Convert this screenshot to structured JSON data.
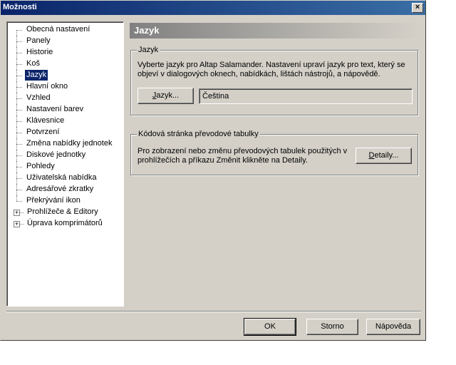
{
  "window": {
    "title": "Možnosti",
    "close_glyph": "×"
  },
  "tree": {
    "items": [
      {
        "label": "Obecná nastavení"
      },
      {
        "label": "Panely"
      },
      {
        "label": "Historie"
      },
      {
        "label": "Koš"
      },
      {
        "label": "Jazyk",
        "selected": true
      },
      {
        "label": "Hlavní okno"
      },
      {
        "label": "Vzhled"
      },
      {
        "label": "Nastavení barev"
      },
      {
        "label": "Klávesnice"
      },
      {
        "label": "Potvrzení"
      },
      {
        "label": "Změna nabídky jednotek"
      },
      {
        "label": "Diskové jednotky"
      },
      {
        "label": "Pohledy"
      },
      {
        "label": "Uživatelská nabídka"
      },
      {
        "label": "Adresářové zkratky"
      },
      {
        "label": "Překrývání ikon"
      },
      {
        "label": "Prohlížeče & Editory",
        "expandable": true
      },
      {
        "label": "Úprava komprimátorů",
        "expandable": true
      }
    ],
    "expander_glyph": "+"
  },
  "page": {
    "title": "Jazyk",
    "language_group": {
      "title": "Jazyk",
      "description_line1": "Vyberte jazyk pro Altap Salamander. Nastavení upraví jazyk pro text, který se",
      "description_line2": "objeví v dialogových oknech, nabídkách, lištách nástrojů, a nápovědě.",
      "button_mnemonic": "J",
      "button_rest": "azyk...",
      "current_language": "Čeština"
    },
    "codepage_group": {
      "title": "Kódová stránka převodové tabulky",
      "description_line1": "Pro zobrazení nebo změnu převodových tabulek použitých v",
      "description_line2": "prohlížečích a příkazu Změnit klikněte na Detaily.",
      "button_mnemonic": "D",
      "button_rest": "etaily..."
    }
  },
  "footer": {
    "ok_label": "OK",
    "cancel_label": "Storno",
    "help_label": "Nápověda"
  }
}
